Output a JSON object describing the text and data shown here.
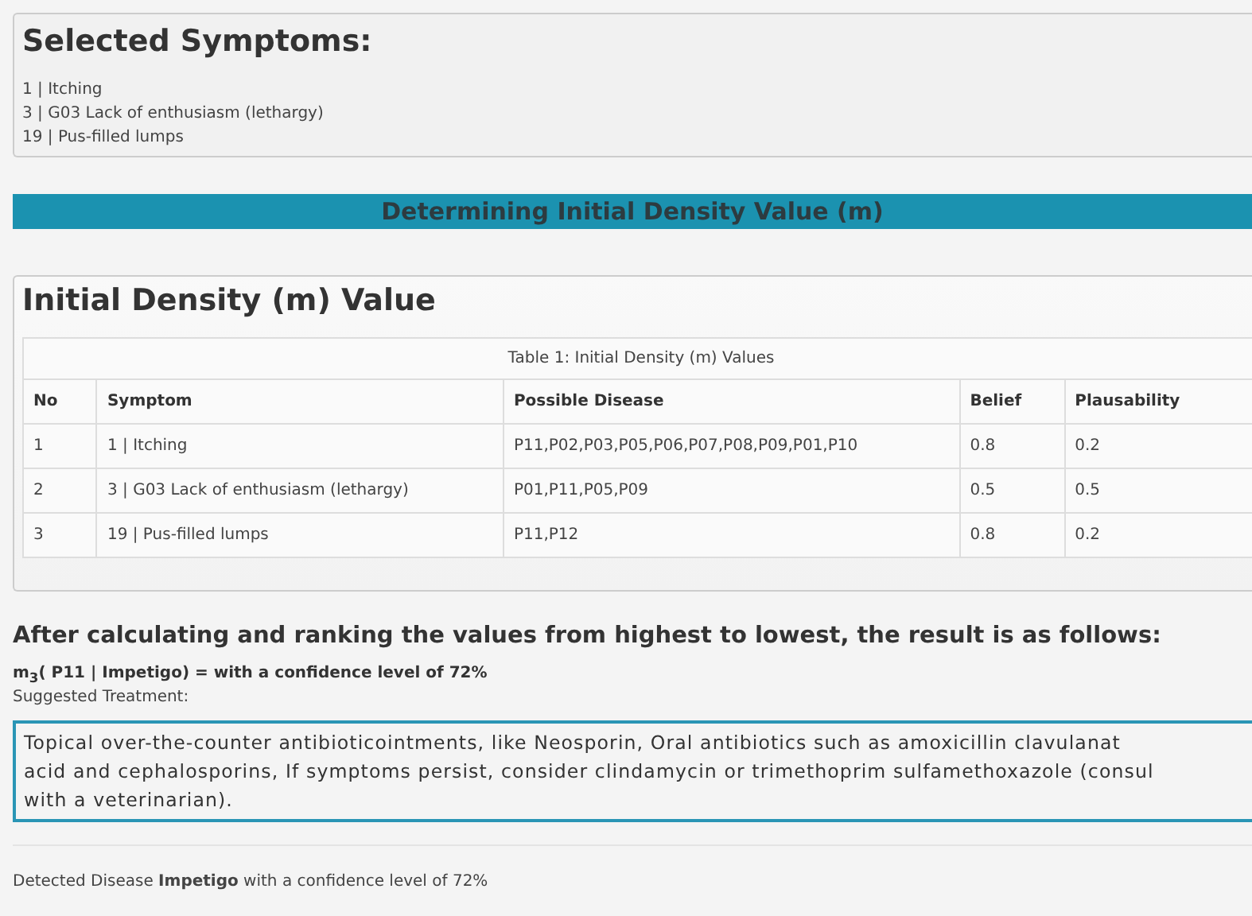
{
  "selected_symptoms": {
    "title": "Selected Symptoms:",
    "items": [
      "1 | Itching",
      "3 | G03 Lack of enthusiasm (lethargy)",
      "19 | Pus-filled lumps"
    ]
  },
  "banner": "Determining Initial Density Value (m)",
  "density_card": {
    "title": "Initial Density (m) Value",
    "table": {
      "caption": "Table 1: Initial Density (m) Values",
      "columns": [
        "No",
        "Symptom",
        "Possible Disease",
        "Belief",
        "Plausability"
      ],
      "rows": [
        [
          "1",
          "1 | Itching",
          "P11,P02,P03,P05,P06,P07,P08,P09,P01,P10",
          "0.8",
          "0.2"
        ],
        [
          "2",
          "3 | G03 Lack of enthusiasm (lethargy)",
          "P01,P11,P05,P09",
          "0.5",
          "0.5"
        ],
        [
          "3",
          "19 | Pus-filled lumps",
          "P11,P12",
          "0.8",
          "0.2"
        ]
      ]
    }
  },
  "result": {
    "heading": "After calculating and ranking the values from highest to lowest, the result is as follows:",
    "formula": "m$_{3}$( P11 | Impetigo) = with a confidence level of 72%",
    "treatment_label": "Suggested Treatment:",
    "treatment_lines": [
      "Topical over-the-counter antibioticointments, like Neosporin, Oral antibiotics such as amoxicillin clavulanat",
      "acid and cephalosporins, If symptoms persist, consider clindamycin or trimethoprim sulfamethoxazole (consul",
      "with a veterinarian)."
    ]
  },
  "detected": "Detected Disease **Impetigo** with a confidence level of 72%"
}
